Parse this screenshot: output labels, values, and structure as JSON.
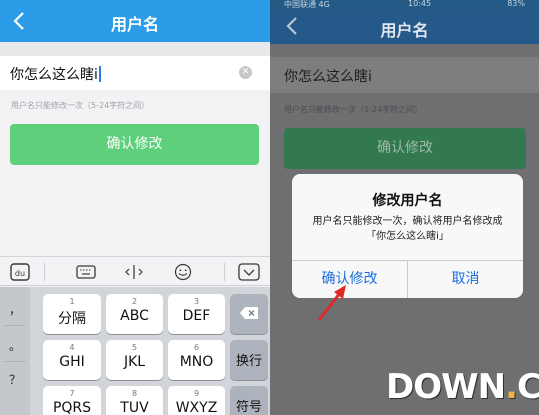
{
  "left": {
    "nav": {
      "title": "用户名"
    },
    "input": {
      "value": "你怎么这么瞎i"
    },
    "hint": "用户名只能修改一次（5-24字符之间）",
    "confirm_label": "确认修改",
    "keyboard": {
      "punctuation": [
        "，",
        "。",
        "？"
      ],
      "keys": [
        {
          "num": "1",
          "label": "分隔"
        },
        {
          "num": "2",
          "label": "ABC"
        },
        {
          "num": "3",
          "label": "DEF"
        },
        {
          "num": "4",
          "label": "GHI"
        },
        {
          "num": "5",
          "label": "JKL"
        },
        {
          "num": "6",
          "label": "MNO"
        },
        {
          "num": "7",
          "label": "PQRS"
        },
        {
          "num": "8",
          "label": "TUV"
        },
        {
          "num": "9",
          "label": "WXYZ"
        }
      ],
      "newline_label": "换行",
      "symbol_label": "符号"
    }
  },
  "right": {
    "status": {
      "carrier": "中国联通  4G",
      "time": "10:45",
      "battery": "83%"
    },
    "nav": {
      "title": "用户名"
    },
    "input": {
      "value": "你怎么这么瞎i"
    },
    "hint": "用户名只能修改一次（5-24字符之间）",
    "confirm_label": "确认修改",
    "dialog": {
      "title": "修改用户名",
      "message": "用户名只能修改一次，确认将用户名修改成「你怎么这么瞎i」",
      "ok": "确认修改",
      "cancel": "取消"
    }
  },
  "watermark": {
    "brand": "DOWN",
    "dot": ".",
    "tld": "CC"
  },
  "colors": {
    "nav_blue": "#2d9ce8",
    "confirm_green": "#5ecf7a",
    "dialog_link": "#1a6fe0",
    "arrow_red": "#e02a2a"
  }
}
